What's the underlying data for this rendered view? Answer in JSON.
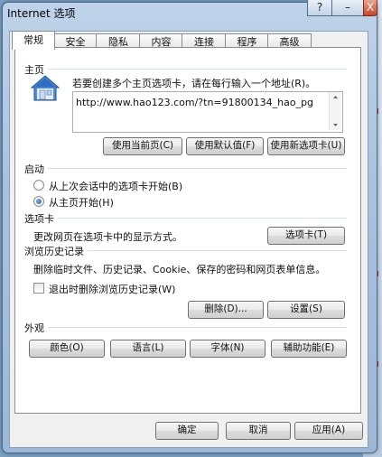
{
  "window": {
    "title": "Internet 选项",
    "help_label": "?",
    "minimize_label": "–",
    "close_label": "X"
  },
  "tabs": [
    {
      "label": "常规"
    },
    {
      "label": "安全"
    },
    {
      "label": "隐私"
    },
    {
      "label": "内容"
    },
    {
      "label": "连接"
    },
    {
      "label": "程序"
    },
    {
      "label": "高级"
    }
  ],
  "homepage": {
    "group_label": "主页",
    "instruction": "若要创建多个主页选项卡，请在每行输入一个地址(R)。",
    "url": "http://www.hao123.com/?tn=91800134_hao_pg",
    "use_current": "使用当前页(C)",
    "use_default": "使用默认值(F)",
    "use_new_tab": "使用新选项卡(U)"
  },
  "startup": {
    "group_label": "启动",
    "option_last_session": "从上次会话中的选项卡开始(B)",
    "option_homepage": "从主页开始(H)"
  },
  "tabs_section": {
    "group_label": "选项卡",
    "description": "更改网页在选项卡中的显示方式。",
    "button": "选项卡(T)"
  },
  "history": {
    "group_label": "浏览历史记录",
    "description": "删除临时文件、历史记录、Cookie、保存的密码和网页表单信息。",
    "checkbox_label": "退出时删除浏览历史记录(W)",
    "delete_button": "删除(D)...",
    "settings_button": "设置(S)"
  },
  "appearance": {
    "group_label": "外观",
    "colors": "颜色(O)",
    "languages": "语言(L)",
    "fonts": "字体(N)",
    "accessibility": "辅助功能(E)"
  },
  "footer": {
    "ok": "确定",
    "cancel": "取消",
    "apply": "应用(A)"
  }
}
